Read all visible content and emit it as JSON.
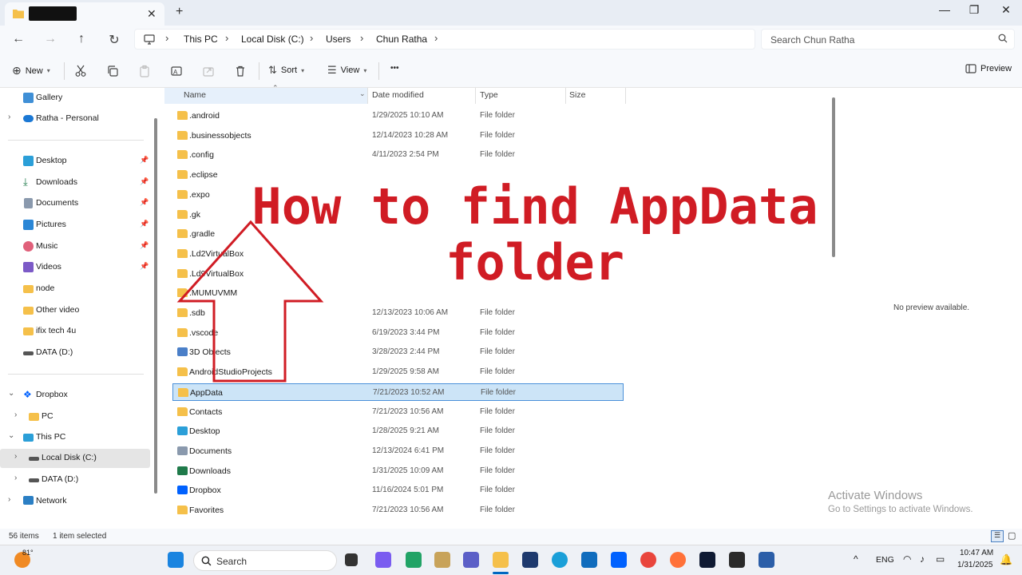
{
  "window": {
    "tab_close": "✕",
    "tab_add": "+",
    "controls": [
      "—",
      "❐",
      "✕"
    ]
  },
  "address": {
    "crumbs": [
      "This PC",
      "Local Disk (C:)",
      "Users",
      "Chun Ratha"
    ],
    "search_placeholder": "Search Chun Ratha"
  },
  "toolbar": {
    "new_label": "New",
    "sort_label": "Sort",
    "view_label": "View",
    "more_label": "•••",
    "preview_label": "Preview"
  },
  "sidebar": {
    "items": [
      {
        "label": "Gallery",
        "icon": "gallery-icon"
      },
      {
        "label": "Ratha - Personal",
        "icon": "cloud-icon"
      },
      {
        "label": "Desktop",
        "icon": "desktop-icon"
      },
      {
        "label": "Downloads",
        "icon": "download-icon"
      },
      {
        "label": "Documents",
        "icon": "documents-icon"
      },
      {
        "label": "Pictures",
        "icon": "pictures-icon"
      },
      {
        "label": "Music",
        "icon": "music-icon"
      },
      {
        "label": "Videos",
        "icon": "videos-icon"
      },
      {
        "label": "node",
        "icon": "folder-icon"
      },
      {
        "label": "Other video",
        "icon": "folder-icon"
      },
      {
        "label": "ifix tech 4u",
        "icon": "folder-icon"
      },
      {
        "label": "DATA (D:)",
        "icon": "drive-icon"
      },
      {
        "label": "Dropbox",
        "icon": "dropbox-icon"
      },
      {
        "label": "PC",
        "icon": "pc-folder-icon"
      },
      {
        "label": "This PC",
        "icon": "this-pc-icon"
      },
      {
        "label": "Local Disk (C:)",
        "icon": "drive-icon"
      },
      {
        "label": "DATA (D:)",
        "icon": "drive-icon"
      },
      {
        "label": "Network",
        "icon": "network-icon"
      }
    ]
  },
  "columns": {
    "name": "Name",
    "date": "Date modified",
    "type": "Type",
    "size": "Size"
  },
  "files": [
    {
      "name": ".android",
      "date": "1/29/2025 10:10 AM",
      "type": "File folder"
    },
    {
      "name": ".businessobjects",
      "date": "12/14/2023 10:28 AM",
      "type": "File folder"
    },
    {
      "name": ".config",
      "date": "4/11/2023 2:54 PM",
      "type": "File folder"
    },
    {
      "name": ".eclipse",
      "date": "",
      "type": ""
    },
    {
      "name": ".expo",
      "date": "",
      "type": ""
    },
    {
      "name": ".gk",
      "date": "",
      "type": ""
    },
    {
      "name": ".gradle",
      "date": "",
      "type": ""
    },
    {
      "name": ".Ld2VirtualBox",
      "date": "",
      "type": ""
    },
    {
      "name": ".Ld9VirtualBox",
      "date": "",
      "type": ""
    },
    {
      "name": ".MUMUVMM",
      "date": "",
      "type": ""
    },
    {
      "name": ".sdb",
      "date": "12/13/2023 10:06 AM",
      "type": "File folder"
    },
    {
      "name": ".vscode",
      "date": "6/19/2023 3:44 PM",
      "type": "File folder"
    },
    {
      "name": "3D Objects",
      "date": "3/28/2023 2:44 PM",
      "type": "File folder"
    },
    {
      "name": "AndroidStudioProjects",
      "date": "1/29/2025 9:58 AM",
      "type": "File folder"
    },
    {
      "name": "AppData",
      "date": "7/21/2023 10:52 AM",
      "type": "File folder"
    },
    {
      "name": "Contacts",
      "date": "7/21/2023 10:56 AM",
      "type": "File folder"
    },
    {
      "name": "Desktop",
      "date": "1/28/2025 9:21 AM",
      "type": "File folder"
    },
    {
      "name": "Documents",
      "date": "12/13/2024 6:41 PM",
      "type": "File folder"
    },
    {
      "name": "Downloads",
      "date": "1/31/2025 10:09 AM",
      "type": "File folder"
    },
    {
      "name": "Dropbox",
      "date": "11/16/2024 5:01 PM",
      "type": "File folder"
    },
    {
      "name": "Favorites",
      "date": "7/21/2023 10:56 AM",
      "type": "File folder"
    }
  ],
  "preview": {
    "message": "No preview available."
  },
  "activation": {
    "line1": "Activate Windows",
    "line2": "Go to Settings to activate Windows."
  },
  "overlay": {
    "line1": "How to find AppData",
    "line2": "folder"
  },
  "status": {
    "items": "56 items",
    "selected": "1 item selected"
  },
  "taskbar": {
    "weather": "81°",
    "search": "Search",
    "lang": "ENG",
    "time": "10:47 AM",
    "date": "1/31/2025"
  },
  "colors": {
    "accent": "#0067c0",
    "overlay": "#d01c24",
    "folder": "#f5c04a"
  }
}
